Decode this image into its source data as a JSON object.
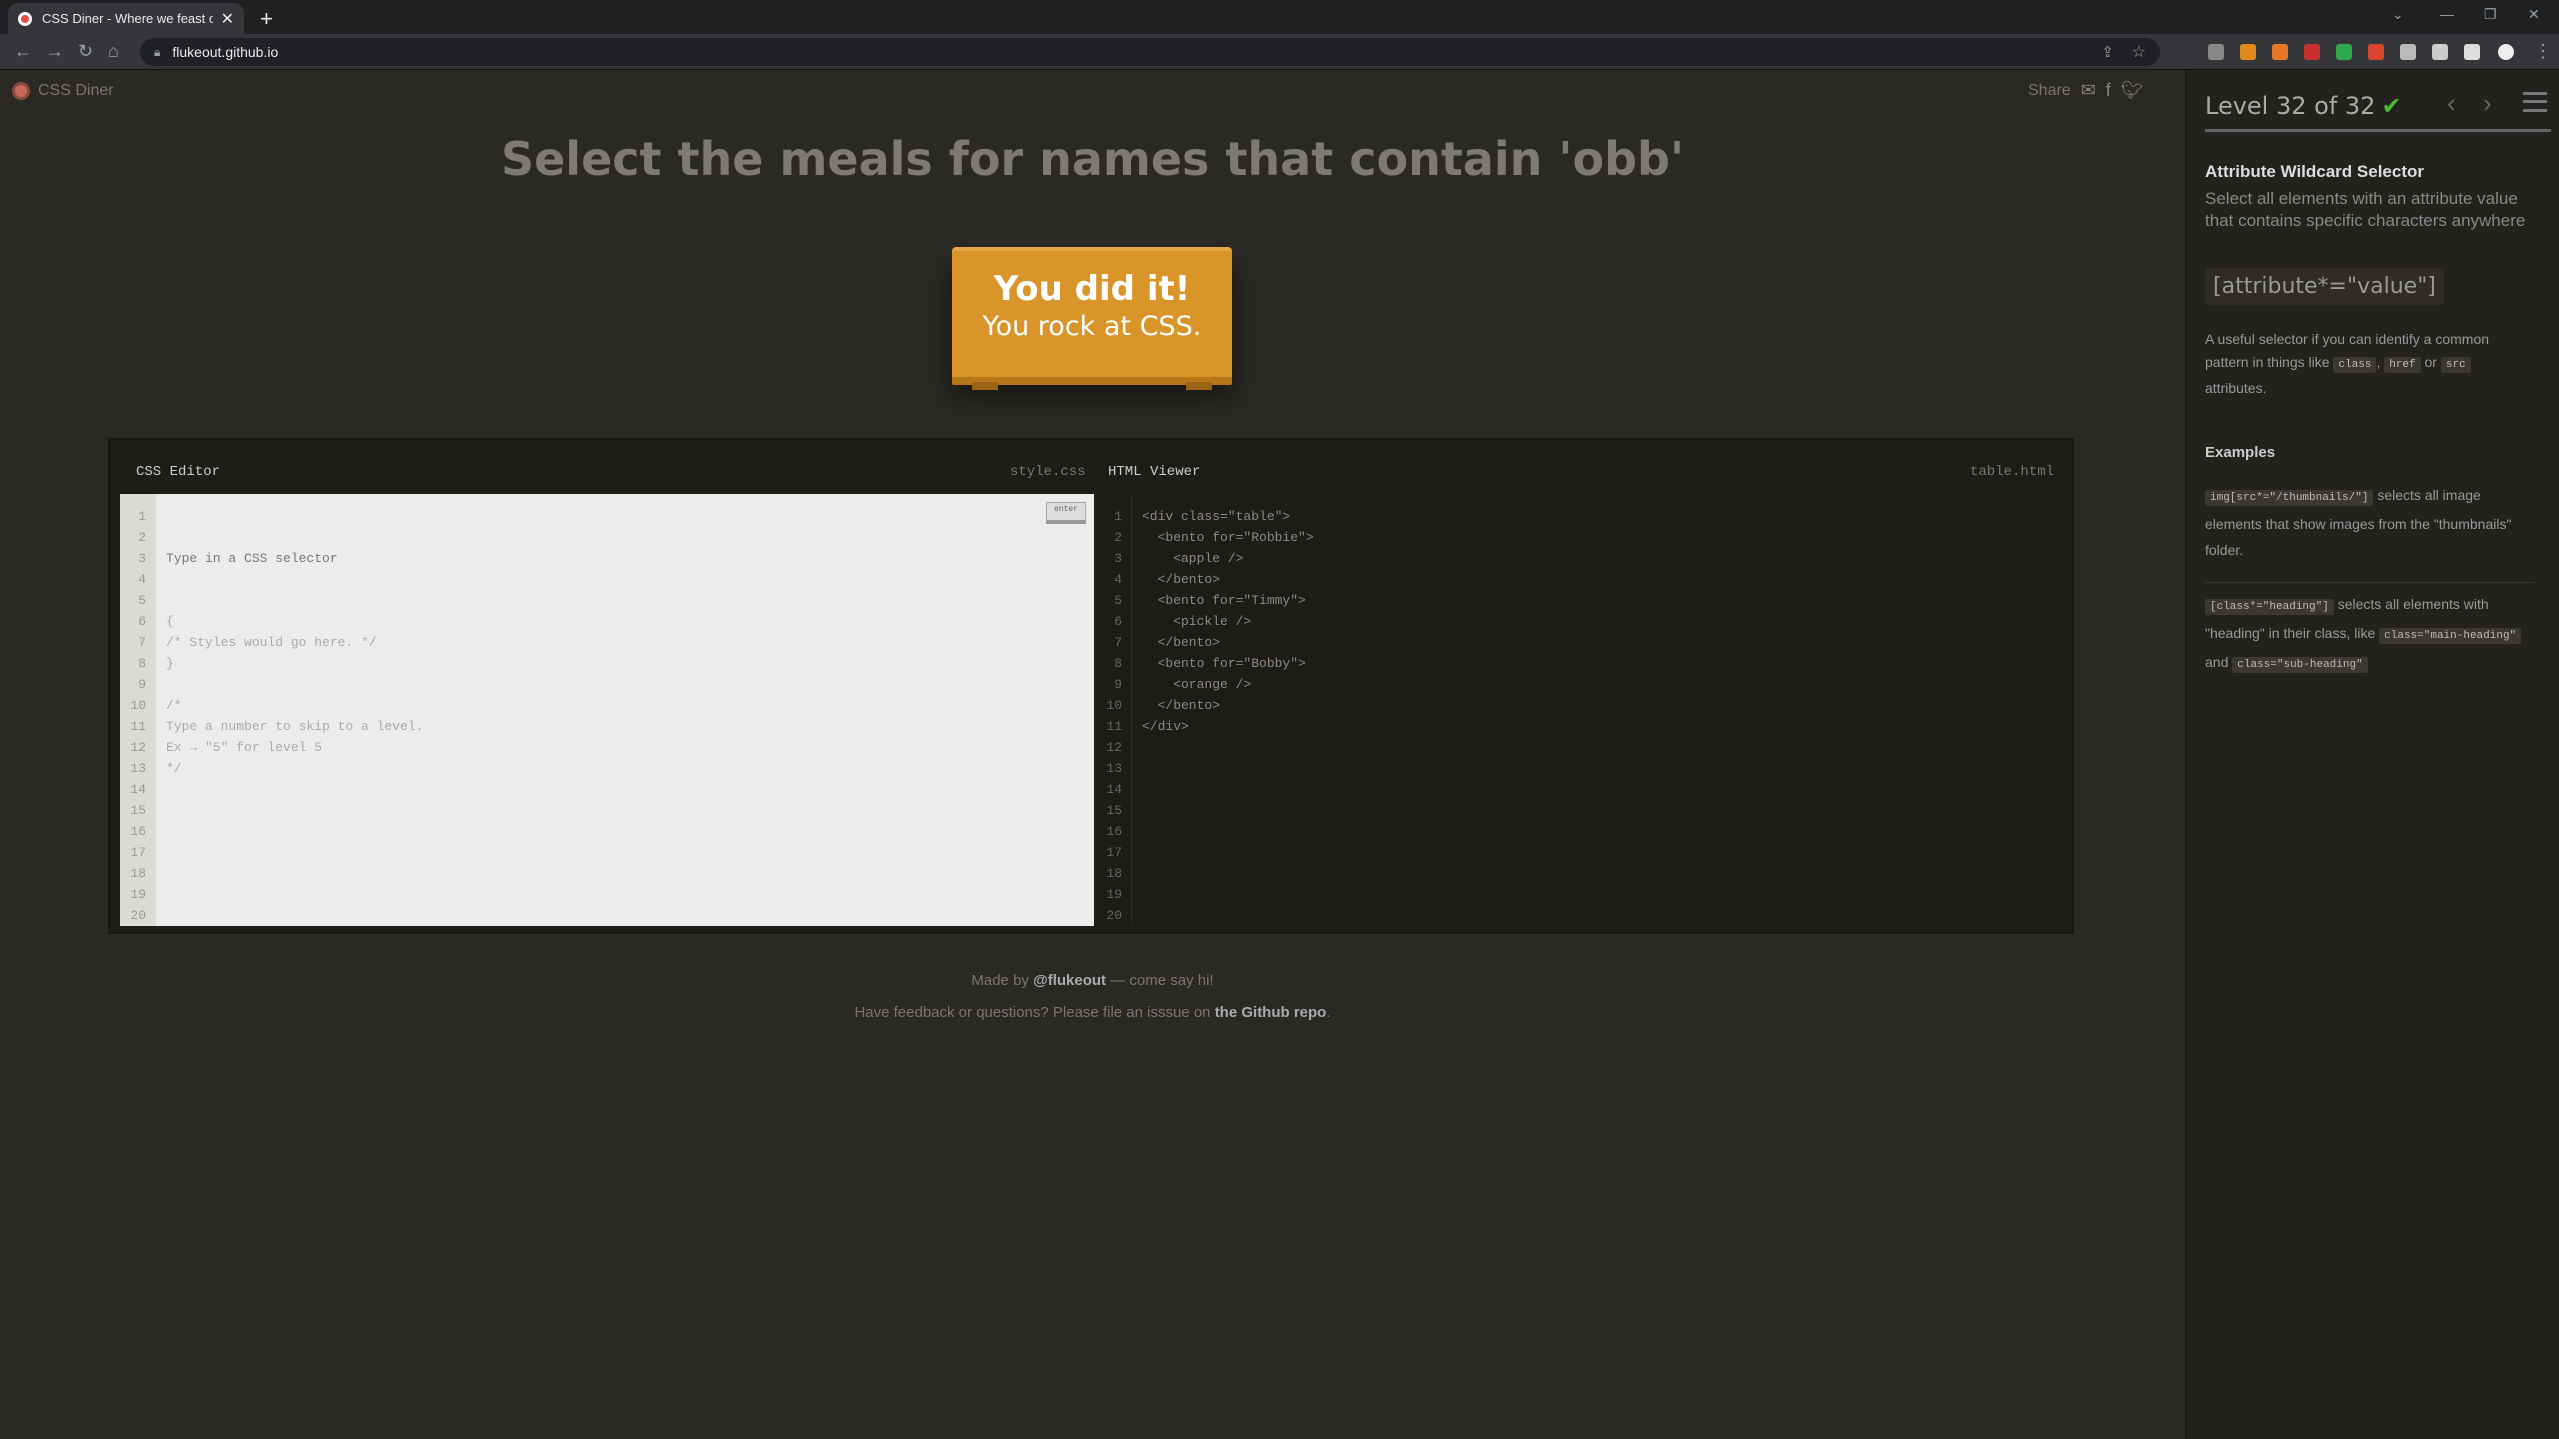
{
  "browser": {
    "tab_title": "CSS Diner - Where we feast on CSS",
    "close_glyph": "✕",
    "newtab_glyph": "+",
    "url": "flukeout.github.io",
    "minimize": "—",
    "maximize": "❐",
    "window_close": "✕",
    "dropdown": "⌄"
  },
  "header": {
    "logo_text": "CSS Diner",
    "share_label": "Share"
  },
  "instruction": "Select the meals for names that contain 'obb'",
  "table_message": {
    "line1": "You did it!",
    "line2": "You rock at CSS."
  },
  "css_editor": {
    "title": "CSS Editor",
    "filename": "style.css",
    "enter_label": "enter",
    "placeholder": "Type in a CSS selector",
    "lines": "{\n/* Styles would go here. */\n}\n\n/*\nType a number to skip to a level.\nEx → \"5\" for level 5\n*/",
    "line_numbers": "1\n2\n3\n4\n5\n6\n7\n8\n9\n10\n11\n12\n13\n14\n15\n16\n17\n18\n19\n20"
  },
  "html_viewer": {
    "title": "HTML Viewer",
    "filename": "table.html",
    "code": "<div class=\"table\">\n  <bento for=\"Robbie\">\n    <apple />\n  </bento>\n  <bento for=\"Timmy\">\n    <pickle />\n  </bento>\n  <bento for=\"Bobby\">\n    <orange />\n  </bento>\n</div>",
    "line_numbers": "1\n2\n3\n4\n5\n6\n7\n8\n9\n10\n11\n12\n13\n14\n15\n16\n17\n18\n19\n20"
  },
  "footer": {
    "made_by_prefix": "Made by",
    "author": "@flukeout",
    "made_by_suffix": "— come say hi!",
    "feedback_prefix": "Have feedback or questions? Please file an isssue on",
    "repo_link": "the Github repo",
    "feedback_suffix": "."
  },
  "sidebar": {
    "level_text": "Level 32 of 32",
    "check_glyph": "✔",
    "prev_glyph": "‹",
    "next_glyph": "›",
    "selector_name": "Attribute Wildcard Selector",
    "selector_description": "Select all elements with an attribute value that contains specific characters anywhere",
    "syntax": "[attribute*=\"value\"]",
    "hint_prefix": "A useful selector if you can identify a common pattern in things like",
    "hint_tag1": "class",
    "hint_sep": ",",
    "hint_tag2": "href",
    "hint_or": "or",
    "hint_tag3": "src",
    "hint_suffix": "attributes.",
    "examples_title": "Examples",
    "example1_code": "img[src*=\"/thumbnails/\"]",
    "example1_text": "selects all image elements that show images from the \"thumbnails\" folder.",
    "example2_code": "[class*=\"heading\"]",
    "example2_text": "selects all elements with \"heading\" in their class, like",
    "example2_tag1": "class=\"main-heading\"",
    "example2_and": "and",
    "example2_tag2": "class=\"sub-heading\""
  },
  "colors": {
    "background": "#2b2925",
    "table": "#d9952a",
    "check": "#4cbb2f"
  }
}
